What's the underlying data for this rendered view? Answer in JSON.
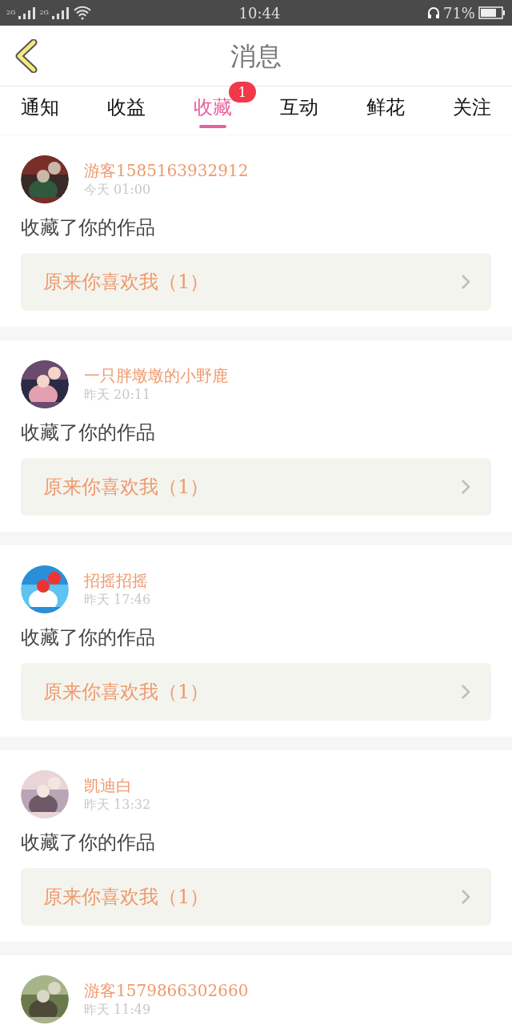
{
  "status_bar": {
    "network_1": "2G",
    "network_2": "2G",
    "time": "10:44",
    "battery": "71%"
  },
  "header": {
    "title": "消息"
  },
  "tabs": [
    {
      "label": "通知",
      "selected": false
    },
    {
      "label": "收益",
      "selected": false
    },
    {
      "label": "收藏",
      "selected": true,
      "badge": "1"
    },
    {
      "label": "互动",
      "selected": false
    },
    {
      "label": "鲜花",
      "selected": false
    },
    {
      "label": "关注",
      "selected": false
    }
  ],
  "messages": [
    {
      "name": "游客1585163932912",
      "time": "今天 01:00",
      "text": "收藏了你的作品",
      "work": "原来你喜欢我（1）"
    },
    {
      "name": "一只胖墩墩的小野鹿",
      "time": "昨天 20:11",
      "text": "收藏了你的作品",
      "work": "原来你喜欢我（1）"
    },
    {
      "name": "招摇招摇",
      "time": "昨天 17:46",
      "text": "收藏了你的作品",
      "work": "原来你喜欢我（1）"
    },
    {
      "name": "凯迪白",
      "time": "昨天 13:32",
      "text": "收藏了你的作品",
      "work": "原来你喜欢我（1）"
    },
    {
      "name": "游客1579866302660",
      "time": "昨天 11:49"
    }
  ]
}
